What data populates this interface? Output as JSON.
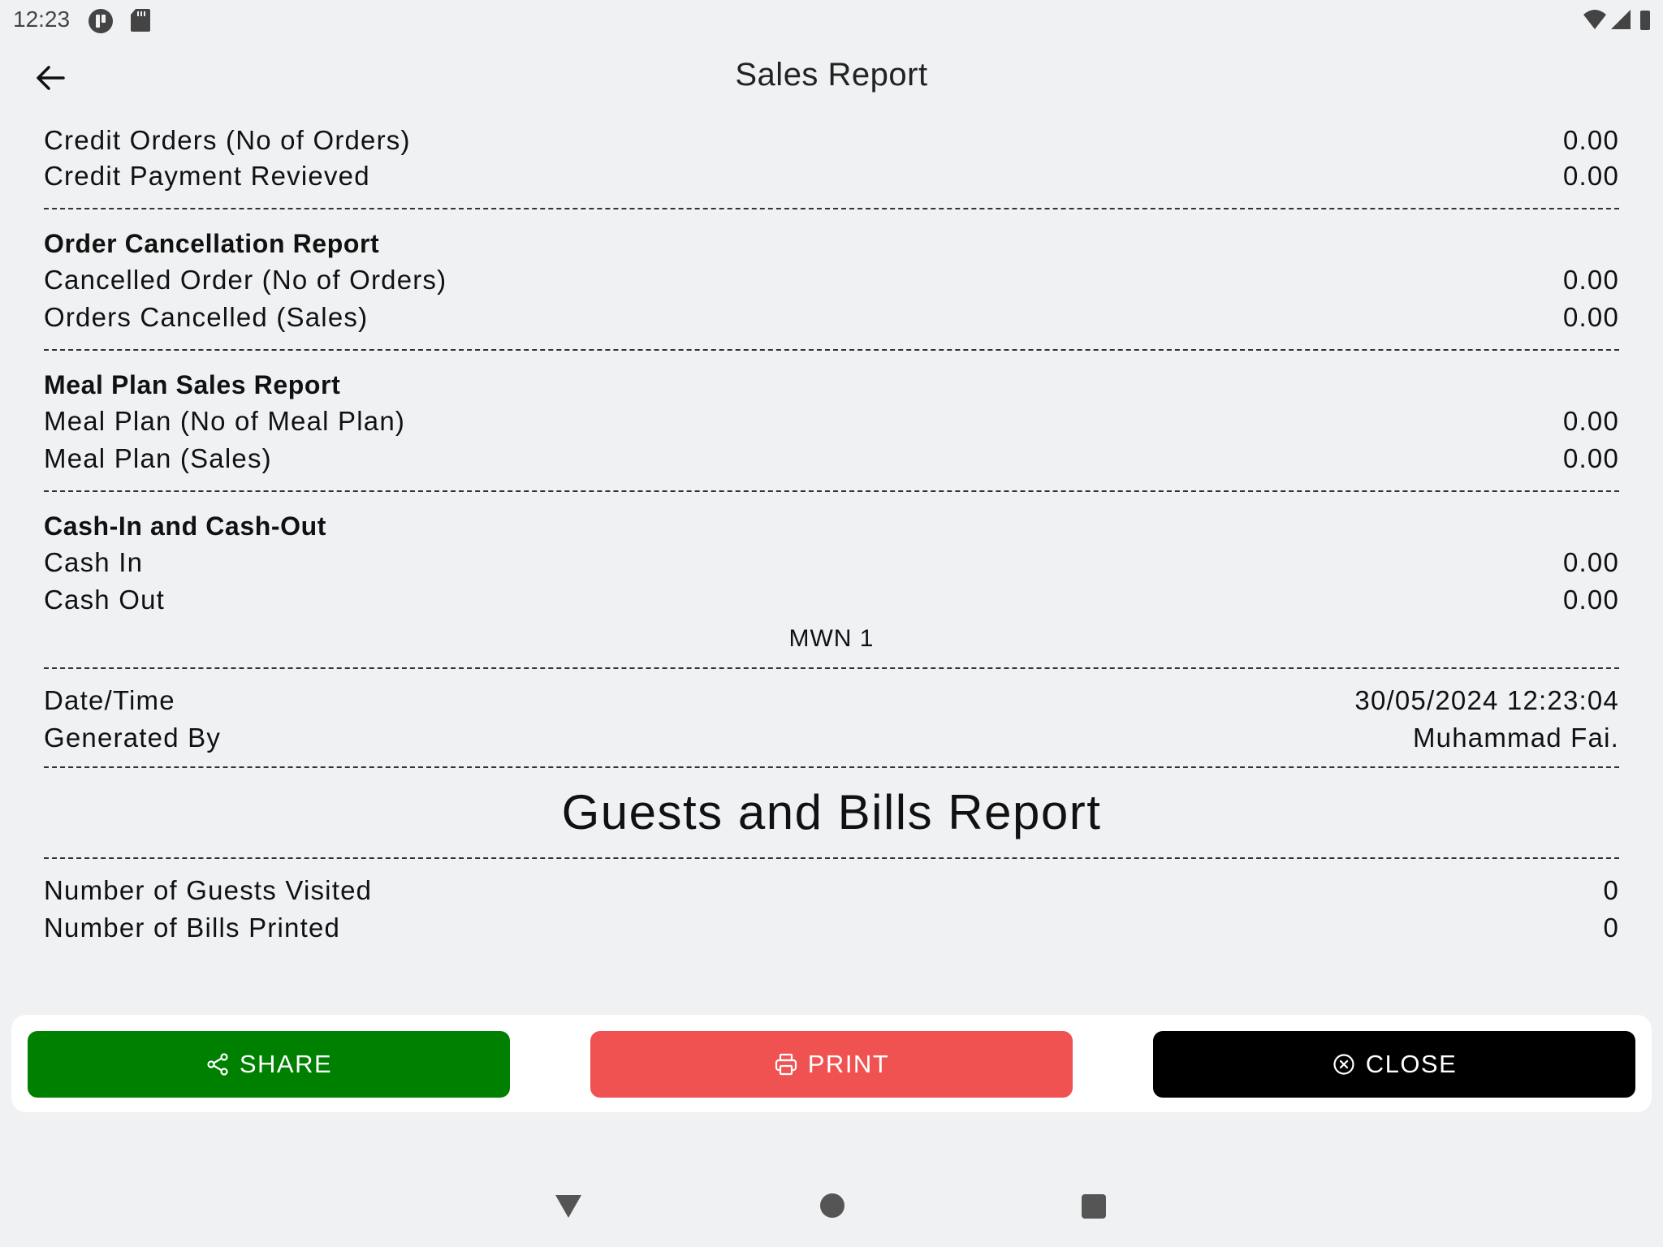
{
  "status_bar": {
    "time": "12:23"
  },
  "app_bar": {
    "title": "Sales Report"
  },
  "report": {
    "credit_orders": {
      "label": "Credit Orders (No of Orders)",
      "value": "0.00"
    },
    "credit_payment": {
      "label": "Credit Payment Revieved",
      "value": "0.00"
    },
    "cancellation": {
      "heading": "Order Cancellation Report",
      "rows": [
        {
          "label": "Cancelled Order (No of Orders)",
          "value": "0.00"
        },
        {
          "label": "Orders Cancelled (Sales)",
          "value": "0.00"
        }
      ]
    },
    "meal_plan": {
      "heading": "Meal Plan Sales Report",
      "rows": [
        {
          "label": "Meal Plan (No of Meal Plan)",
          "value": "0.00"
        },
        {
          "label": "Meal Plan (Sales)",
          "value": "0.00"
        }
      ]
    },
    "cash": {
      "heading": "Cash-In and Cash-Out",
      "rows": [
        {
          "label": "Cash In",
          "value": "0.00"
        },
        {
          "label": "Cash Out",
          "value": "0.00"
        }
      ]
    },
    "terminal": "MWN 1",
    "meta": {
      "rows": [
        {
          "label": "Date/Time",
          "value": "30/05/2024 12:23:04"
        },
        {
          "label": "Generated By",
          "value": "Muhammad Fai."
        }
      ]
    },
    "guests_bills": {
      "title": "Guests and Bills Report",
      "rows": [
        {
          "label": "Number of Guests Visited",
          "value": "0"
        },
        {
          "label": "Number of Bills Printed",
          "value": "0"
        }
      ]
    }
  },
  "actions": {
    "share": "SHARE",
    "print": "PRINT",
    "close": "CLOSE"
  },
  "colors": {
    "share": "#008000",
    "print": "#f05252",
    "close": "#000000",
    "background": "#f0f1f3"
  }
}
